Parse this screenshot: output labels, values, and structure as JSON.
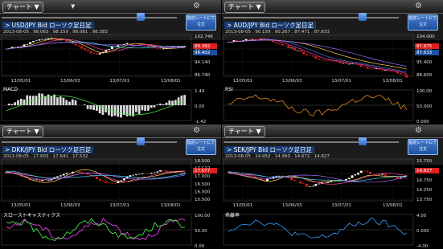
{
  "ui": {
    "chart_button": "チャート",
    "rate_button": "指定レートにて注文",
    "date_labels": [
      "13/05/01",
      "13/06/03",
      "13/07/01",
      "13/08/01"
    ]
  },
  "colors": {
    "accent": "#1d4f9d",
    "sell_line": "#e0303a",
    "buy_line": "#3a7de0",
    "candle_up": "#ffffff",
    "candle_down": "#e02020"
  },
  "panels": [
    {
      "title": "> USD/JPY Bid ローソク足日足",
      "info": "2013-08-05 . 98.063 . 98.159 . 98.081 . 98.383",
      "price_ticks": [
        "102.748",
        "96.530",
        "94.140",
        "86.740"
      ],
      "price_labels": [
        {
          "text": "99.382",
          "color": "#e02020"
        },
        {
          "text": "98.402",
          "color": "#1d4f9d"
        }
      ],
      "indicator": "MACD",
      "indicator_ticks": [
        "1.44",
        "0.00",
        "-1.42"
      ],
      "slider_pos": 0.78
    },
    {
      "title": "> AUD/JPY Bid ローソク足日足",
      "info": "2013-08-05 . 90.159 . 90.267 . 87.471 . 87.633",
      "price_ticks": [
        "104.000",
        "97.000",
        "95.400",
        "88.600"
      ],
      "price_labels": [
        {
          "text": "87.675",
          "color": "#e02020"
        },
        {
          "text": "87.633",
          "color": "#1d4f9d"
        }
      ],
      "indicator": "RSI",
      "indicator_ticks": [
        "100.00",
        "50.000",
        "0.000"
      ],
      "slider_pos": 0.78
    },
    {
      "title": "> DKK/JPY Bid ローソク足日足",
      "info": "2013-08-05 . 17.603 . 17.641 . 17.532",
      "price_ticks": [
        "18.500",
        "17.577",
        "17.000",
        "16.500",
        "16.000",
        "15.500"
      ],
      "price_labels": [
        {
          "text": "17.577",
          "color": "#e02020"
        }
      ],
      "indicator": "スローストキャスティクス",
      "indicator_ticks": [
        "100.00",
        "50.00",
        "0.00"
      ],
      "slider_pos": 0.78
    },
    {
      "title": "> SEK/JPY Bid ローソク足日足",
      "info": "2013-08-05 . 14.952 . 14.960 . 14.672 . 14.827",
      "price_ticks": [
        "15.750",
        "15.250",
        "14.750",
        "14.250",
        "13.750"
      ],
      "price_labels": [
        {
          "text": "14.827",
          "color": "#e02020"
        }
      ],
      "indicator": "乖離率",
      "indicator_ticks": [
        "4.00",
        "0.000",
        "-4.00"
      ],
      "slider_pos": 0.78
    }
  ],
  "chart_data": [
    {
      "type": "line",
      "title": "USD/JPY",
      "series": [
        {
          "values": [
            97.5,
            98.2,
            99,
            100.5,
            101.6,
            101.9,
            101.2,
            100.4,
            98.6,
            96.4,
            95.2,
            96.5,
            98.4,
            99.2,
            99.8,
            99.6,
            98.4,
            97.6,
            97.9,
            98.1,
            98.4
          ]
        }
      ],
      "ylim": [
        86.74,
        102.748
      ]
    },
    {
      "type": "line",
      "title": "AUD/JPY",
      "series": [
        {
          "values": [
            101.8,
            102.2,
            102.6,
            103.0,
            102.7,
            101.9,
            100.6,
            99.2,
            97.8,
            96.2,
            94.9,
            94.4,
            93.8,
            93.2,
            92.7,
            91.8,
            91.2,
            90.8,
            90.2,
            89.4,
            87.7
          ]
        }
      ],
      "ylim": [
        88.6,
        104.0
      ]
    },
    {
      "type": "line",
      "title": "DKK/JPY",
      "series": [
        {
          "values": [
            17.6,
            17.5,
            17.2,
            17.0,
            16.95,
            17.05,
            17.3,
            17.55,
            17.65,
            17.45,
            17.15,
            16.85,
            16.75,
            17.05,
            17.35,
            17.45,
            17.55,
            17.7,
            17.65,
            17.6,
            17.58
          ]
        }
      ],
      "ylim": [
        15.5,
        18.5
      ]
    },
    {
      "type": "line",
      "title": "SEK/JPY",
      "series": [
        {
          "values": [
            15.15,
            15.05,
            15.0,
            14.9,
            14.7,
            14.9,
            15.0,
            14.8,
            14.6,
            14.4,
            14.55,
            14.6,
            14.75,
            14.7,
            15.0,
            15.2,
            15.1,
            15.05,
            14.95,
            14.85,
            14.83
          ]
        }
      ],
      "ylim": [
        13.75,
        15.75
      ]
    }
  ]
}
